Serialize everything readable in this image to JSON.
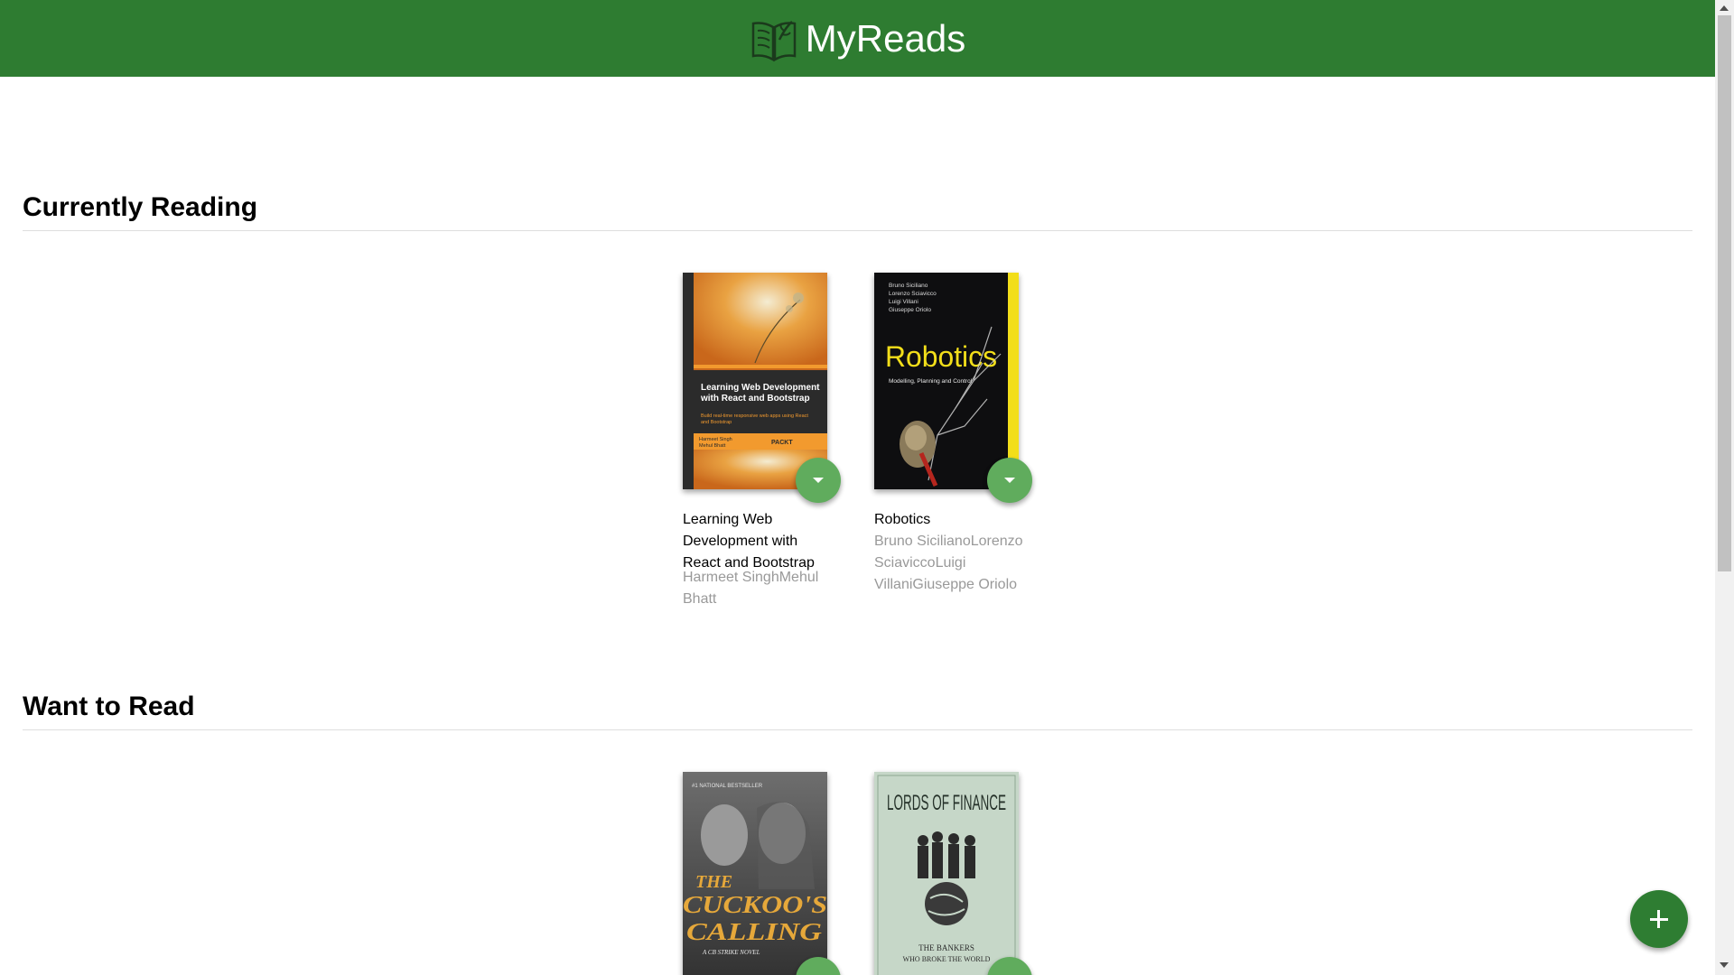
{
  "header": {
    "title": "MyReads",
    "background": "#2e7c31"
  },
  "shelves": [
    {
      "title": "Currently Reading",
      "books": [
        {
          "title": "Learning Web Development with React and Bootstrap",
          "authors": "Harmeet SinghMehul Bhatt",
          "cover_text": {
            "heading": "Learning Web Development with React and Bootstrap",
            "subtitle": "Build real-time responsive web apps using React and Bootstrap",
            "cover_authors": "Harmeet Singh Mehul Bhatt",
            "publisher": "PACKT"
          }
        },
        {
          "title": "Robotics",
          "authors": "Bruno SicilianoLorenzo SciaviccoLuigi VillaniGiuseppe Oriolo",
          "cover_text": {
            "heading": "Robotics",
            "subtitle": "Modelling, Planning and Control",
            "cover_authors": [
              "Bruno Siciliano",
              "Lorenzo Sciavicco",
              "Luigi Villani",
              "Giuseppe Oriolo"
            ]
          }
        }
      ]
    },
    {
      "title": "Want to Read",
      "books": [
        {
          "title": "The Cuckoo's Calling",
          "authors": "",
          "cover_text": {
            "banner": "#1 NATIONAL BESTSELLER",
            "heading_line1": "THE",
            "heading_line2": "CUCKOO'S",
            "heading_line3": "CALLING",
            "tagline": "A CB STRIKE NOVEL"
          }
        },
        {
          "title": "Lords of Finance",
          "authors": "",
          "cover_text": {
            "heading": "LORDS OF FINANCE",
            "subtitle_line1": "THE BANKERS",
            "subtitle_line2": "WHO BROKE THE WORLD"
          }
        }
      ]
    }
  ],
  "colors": {
    "accent": "#2e7d32",
    "shelf_changer": "#60ac5d",
    "author_text": "#999999"
  },
  "icons": {
    "logo": "open-book-icon",
    "shelf_changer": "caret-down-icon",
    "add": "plus-icon"
  }
}
